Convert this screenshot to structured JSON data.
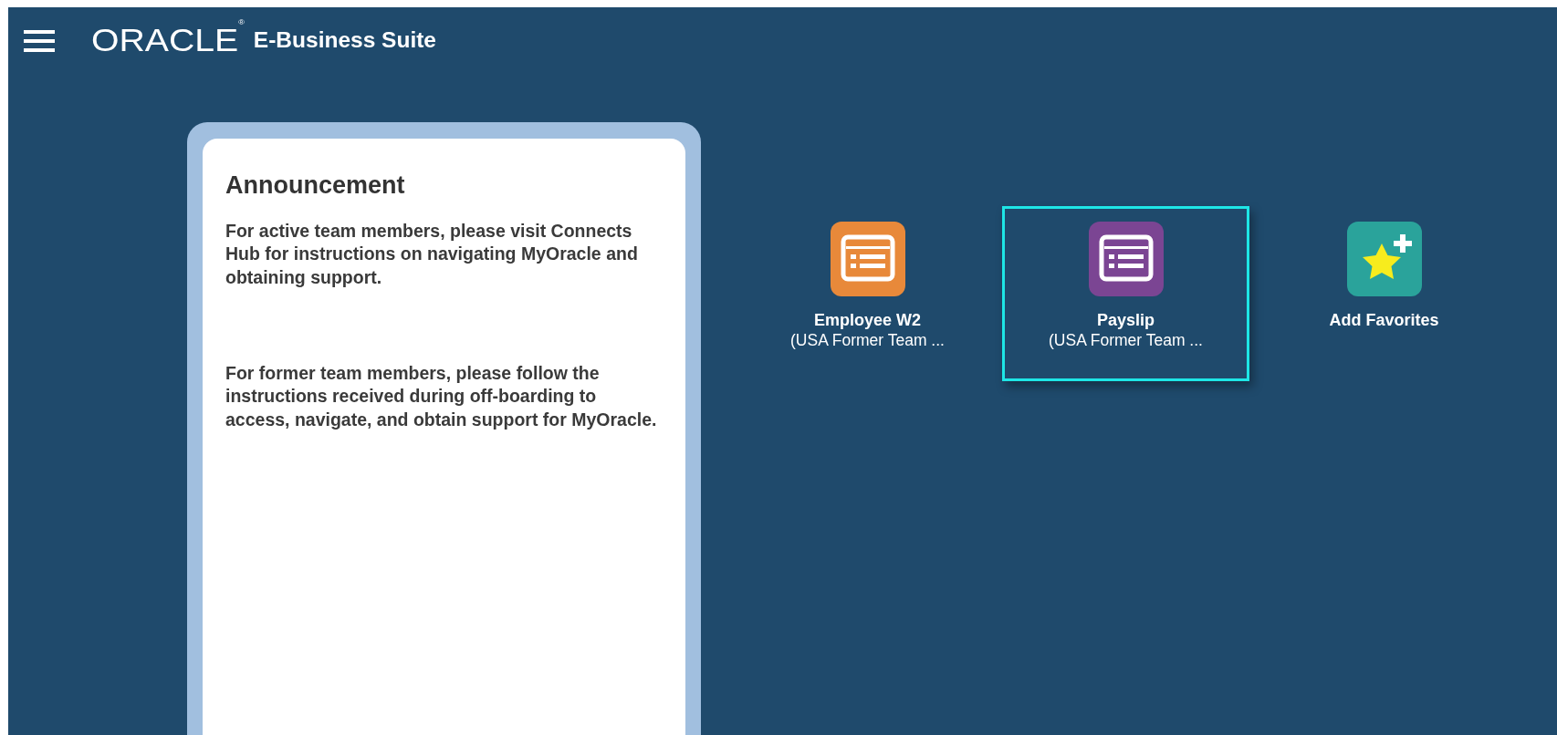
{
  "header": {
    "logo": "ORACLE",
    "logo_mark": "®",
    "product": "E-Business Suite"
  },
  "announcement": {
    "title": "Announcement",
    "paragraphs": [
      "For active team members, please visit Connects Hub for instructions on navigating MyOracle and obtaining support.",
      "For former team members, please follow the instructions received during off-boarding to access, navigate, and obtain support for MyOracle."
    ]
  },
  "tiles": [
    {
      "kind": "app",
      "label": "Employee W2",
      "sublabel": "(USA Former Team ...",
      "color": "#e8893a",
      "selected": false
    },
    {
      "kind": "app",
      "label": "Payslip",
      "sublabel": "(USA Former Team ...",
      "color": "#7b4593",
      "selected": true
    },
    {
      "kind": "add",
      "label": "Add Favorites",
      "color": "#2aa39b",
      "selected": false
    }
  ]
}
